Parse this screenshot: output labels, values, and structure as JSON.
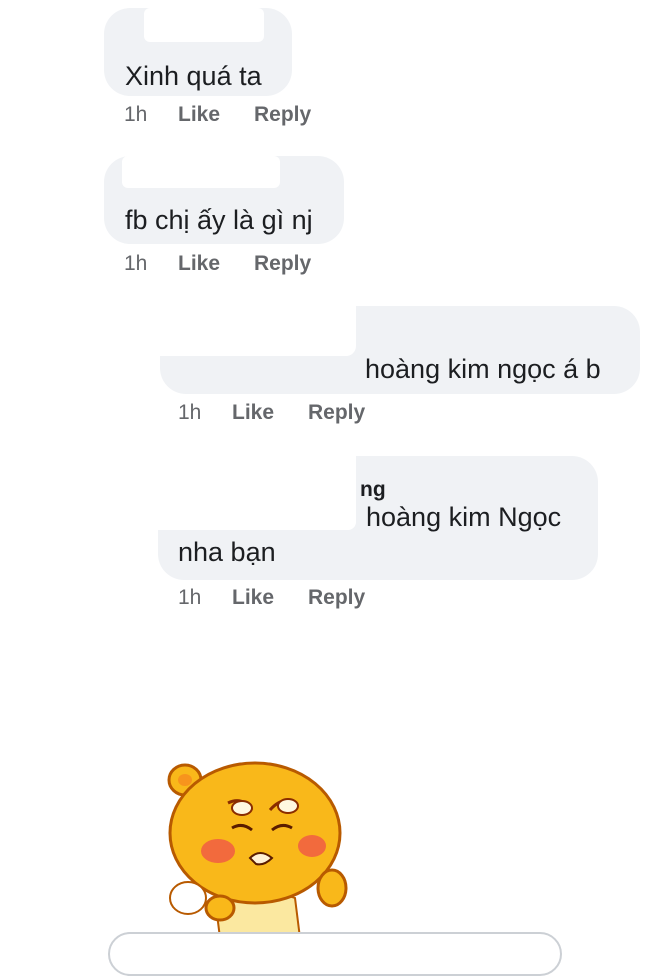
{
  "comments": [
    {
      "text": "Xinh quá ta",
      "author": "",
      "time": "1h",
      "like": "Like",
      "reply": "Reply"
    },
    {
      "text": "fb chị ấy là gì nj",
      "author": "",
      "time": "1h",
      "like": "Like",
      "reply": "Reply"
    },
    {
      "text": "hoàng kim ngọc á b",
      "author": "",
      "time": "1h",
      "like": "Like",
      "reply": "Reply"
    },
    {
      "author": "ng",
      "text_line1": "hoàng kim Ngọc",
      "text_line2": "nha bạn",
      "time": "1h",
      "like": "Like",
      "reply": "Reply"
    }
  ],
  "sticker": {
    "icon": "angry-yellow-bear-sticker-icon"
  },
  "composer": {
    "placeholder": ""
  },
  "colors": {
    "bubble": "#f0f2f5",
    "meta": "#65676b",
    "text": "#1c1e21",
    "sticker": "#f9b81a"
  }
}
